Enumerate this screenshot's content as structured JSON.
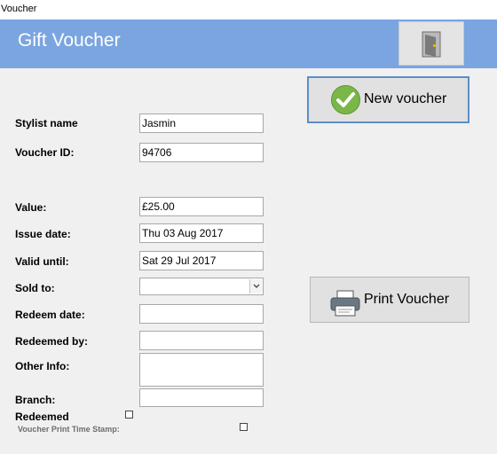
{
  "window": {
    "title": "Voucher"
  },
  "header": {
    "title": "Gift Voucher",
    "exit_icon": "door-exit-icon",
    "color": "#7aa5e0"
  },
  "buttons": {
    "new_voucher": "New voucher",
    "print_voucher": "Print Voucher"
  },
  "form": {
    "stylist_name": {
      "label": "Stylist name",
      "value": "Jasmin"
    },
    "voucher_id": {
      "label": "Voucher ID:",
      "value": "94706"
    },
    "value": {
      "label": "Value:",
      "value": "£25.00"
    },
    "issue_date": {
      "label": "Issue date:",
      "value": "Thu 03 Aug 2017"
    },
    "valid_until": {
      "label": "Valid  until:",
      "value": "Sat 29 Jul 2017"
    },
    "sold_to": {
      "label": "Sold to:",
      "value": ""
    },
    "redeem_date": {
      "label": "Redeem date:",
      "value": ""
    },
    "redeemed_by": {
      "label": "Redeemed by:",
      "value": ""
    },
    "other_info": {
      "label": "Other Info:",
      "value": ""
    },
    "branch": {
      "label": "Branch:",
      "value": ""
    },
    "redeemed": {
      "label": "Redeemed",
      "checked": false
    },
    "print_time_stamp": {
      "label": "Voucher Print Time Stamp:",
      "checked": false
    }
  }
}
